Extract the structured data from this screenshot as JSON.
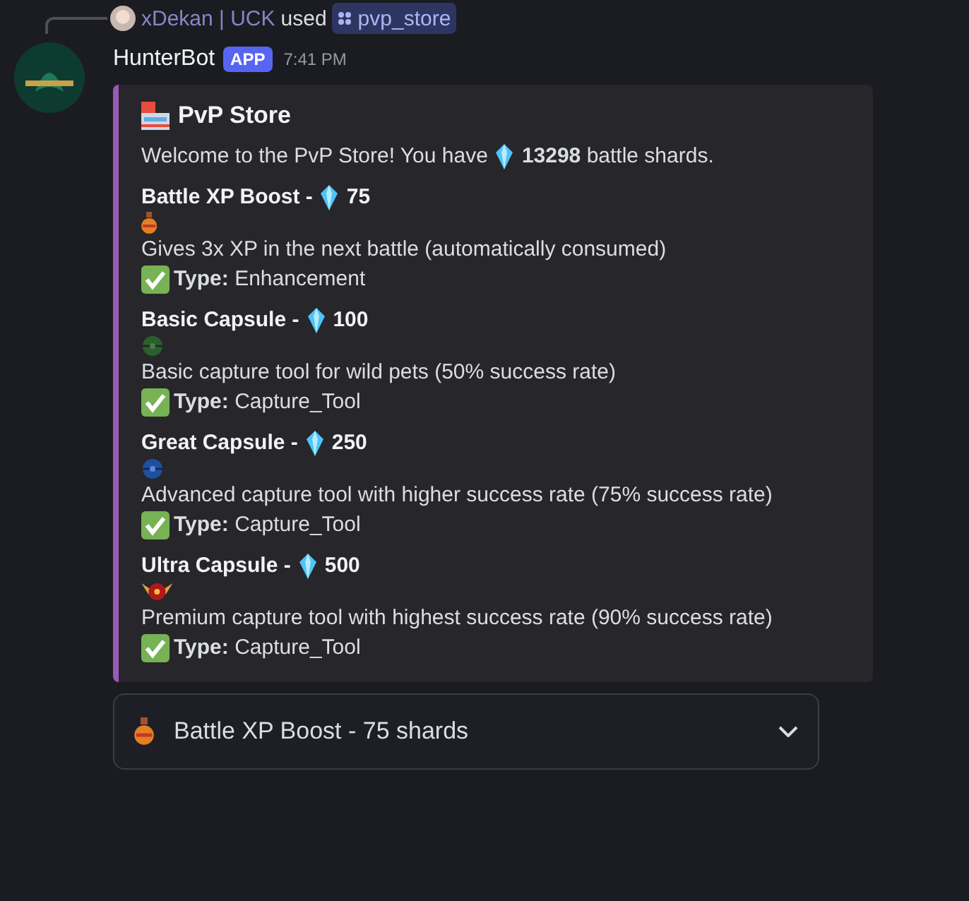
{
  "reply": {
    "user": "xDekan | UCK",
    "verb": "used",
    "command": "pvp_store"
  },
  "message": {
    "author": "HunterBot",
    "badge": "APP",
    "time": "7:41 PM"
  },
  "embed": {
    "title": "PvP Store",
    "intro_before": "Welcome to the PvP Store! You have",
    "intro_after": "**13298** battle shards.",
    "items": [
      {
        "kind": "potion",
        "name": "Battle XP Boost -",
        "price": "75",
        "description": "Gives 3x XP in the next battle (automatically consumed)",
        "type": "**Type:** Enhancement"
      },
      {
        "kind": "basic",
        "name": "Basic Capsule -",
        "price": "100",
        "description": "Basic capture tool for wild pets (50% success rate)",
        "type": "**Type:** Capture_Tool"
      },
      {
        "kind": "great",
        "name": "Great Capsule -",
        "price": "250",
        "description": "Advanced capture tool with higher success rate (75% success rate)",
        "type": "**Type:** Capture_Tool"
      },
      {
        "kind": "ultra",
        "name": "Ultra Capsule -",
        "price": "500",
        "description": "Premium capture tool with highest success rate (90% success rate)",
        "type": "**Type:** Capture_Tool"
      }
    ]
  },
  "select": {
    "kind": "potion",
    "value": "Battle XP Boost - 75 shards"
  }
}
